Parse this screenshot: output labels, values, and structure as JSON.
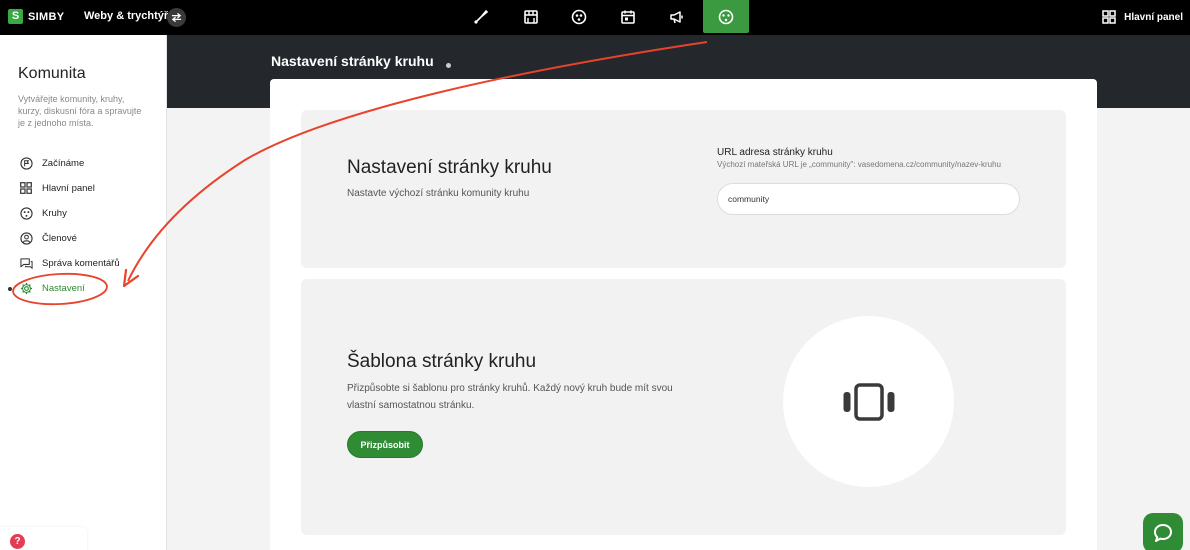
{
  "topbar": {
    "logo_letter": "S",
    "logo_text": "SIMBY",
    "site_name": "Weby & trychtýře",
    "dashboard_label": "Hlavní panel",
    "nav_icons": [
      "brush-icon",
      "store-icon",
      "community-icon",
      "calendar-icon",
      "megaphone-icon",
      "circles-icon"
    ],
    "active_nav": "circles-icon"
  },
  "sidebar": {
    "title": "Komunita",
    "description": "Vytvářejte komunity, kruhy, kurzy, diskusní fóra a spravujte je z jednoho místa.",
    "items": [
      {
        "label": "Začínáme",
        "icon": "flag-icon"
      },
      {
        "label": "Hlavní panel",
        "icon": "dashboard-icon"
      },
      {
        "label": "Kruhy",
        "icon": "circles-icon"
      },
      {
        "label": "Členové",
        "icon": "member-icon"
      },
      {
        "label": "Správa komentářů",
        "icon": "comments-icon"
      },
      {
        "label": "Nastavení",
        "icon": "gear-icon",
        "active": true
      }
    ],
    "help_label": "?"
  },
  "main": {
    "page_title": "Nastavení stránky kruhu",
    "settings_panel": {
      "heading": "Nastavení stránky kruhu",
      "text": "Nastavte výchozí stránku komunity kruhu",
      "url_label": "URL adresa stránky kruhu",
      "url_hint": "Výchozí mateřská URL je „community\": vasedomena.cz/community/nazev-kruhu",
      "url_value": "community"
    },
    "template_panel": {
      "heading": "Šablona stránky kruhu",
      "text": "Přizpůsobte si šablonu pro stránky kruhů. Každý nový kruh bude mít svou vlastní samostatnou stránku.",
      "button_label": "Přizpůsobit",
      "illustration_icon": "carousel-icon"
    }
  },
  "colors": {
    "accent_green": "#2f8b34",
    "annotation_red": "#e8432c",
    "header_dark": "#24282d"
  }
}
